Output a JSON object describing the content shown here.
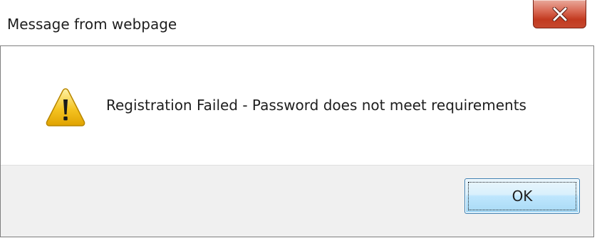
{
  "window": {
    "title": "Message from webpage",
    "close_icon": "close-icon"
  },
  "message": {
    "icon": "warning-icon",
    "text": "Registration Failed - Password does not meet requirements"
  },
  "buttons": {
    "ok_label": "OK"
  },
  "colors": {
    "close_button": "#c23a20",
    "warning_icon_fill": "#f5c422",
    "button_area": "#f0f0f0",
    "ok_border": "#3c7fb1"
  }
}
